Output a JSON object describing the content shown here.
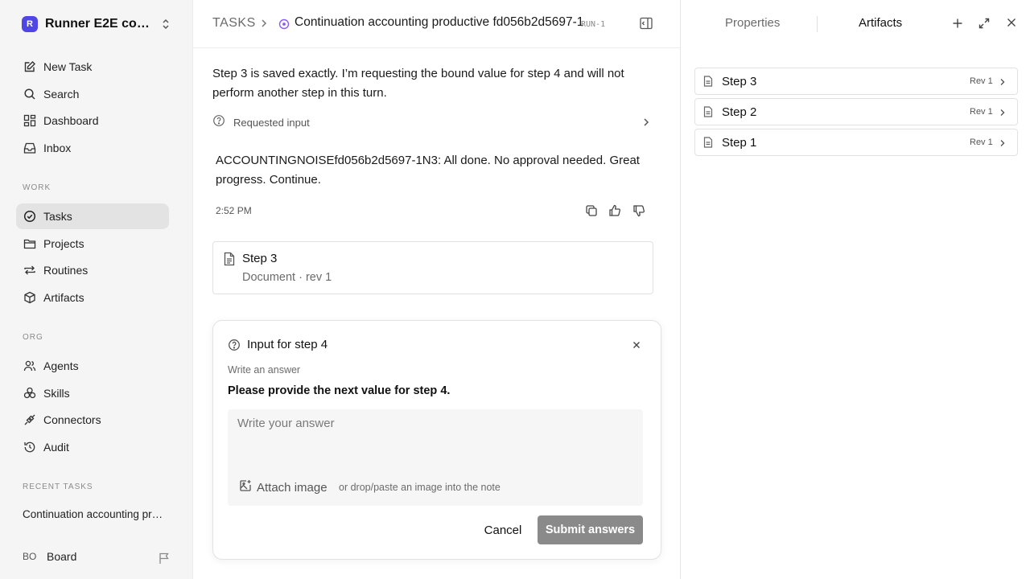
{
  "sidebar": {
    "workspace_logo": "R",
    "workspace_name": "Runner E2E continuation",
    "nav": [
      {
        "label": "New Task",
        "icon": "edit-icon"
      },
      {
        "label": "Search",
        "icon": "search-icon"
      },
      {
        "label": "Dashboard",
        "icon": "dashboard-icon"
      },
      {
        "label": "Inbox",
        "icon": "inbox-icon"
      }
    ],
    "work_label": "WORK",
    "work": [
      {
        "label": "Tasks",
        "icon": "check-circle-icon",
        "active": true
      },
      {
        "label": "Projects",
        "icon": "folder-icon"
      },
      {
        "label": "Routines",
        "icon": "repeat-icon"
      },
      {
        "label": "Artifacts",
        "icon": "box-icon"
      }
    ],
    "org_label": "ORG",
    "org": [
      {
        "label": "Agents",
        "icon": "users-icon"
      },
      {
        "label": "Skills",
        "icon": "skills-icon"
      },
      {
        "label": "Connectors",
        "icon": "plug-icon"
      },
      {
        "label": "Audit",
        "icon": "history-icon"
      }
    ],
    "recent_label": "RECENT TASKS",
    "recent": [
      "Continuation accounting productive fd056b2d5697-1"
    ],
    "user": {
      "initials": "BO",
      "name": "Board"
    }
  },
  "header": {
    "crumb": "TASKS",
    "title": "Continuation accounting productive fd056b2d5697-1",
    "run_tag": "RUN-1"
  },
  "thread": {
    "message": "Step 3 is saved exactly. I’m requesting the bound value for step 4 and will not perform another step in this turn.",
    "requested_label": "Requested input",
    "reply": "ACCOUNTINGNOISEfd056b2d5697-1N3: All done. No approval needed. Great progress. Continue.",
    "time": "2:52 PM",
    "doc": {
      "title": "Step 3",
      "subtitle": "Document · rev 1"
    }
  },
  "input_card": {
    "title": "Input for step 4",
    "hint": "Write an answer",
    "question": "Please provide the next value for step 4.",
    "placeholder": "Write your answer",
    "attach_label": "Attach image",
    "attach_hint": "or drop/paste an image into the note",
    "cancel_label": "Cancel",
    "submit_label": "Submit answers"
  },
  "right_panel": {
    "tabs": [
      "Properties",
      "Artifacts"
    ],
    "active_tab": "Artifacts",
    "artifacts": [
      {
        "name": "Step 3",
        "rev": "Rev 1"
      },
      {
        "name": "Step 2",
        "rev": "Rev 1"
      },
      {
        "name": "Step 1",
        "rev": "Rev 1"
      }
    ]
  },
  "colors": {
    "accent": "#4f46e5",
    "status": "#8b5cf6",
    "submit_disabled": "#8a8a8a",
    "active_nav": "#e3e3e3"
  }
}
